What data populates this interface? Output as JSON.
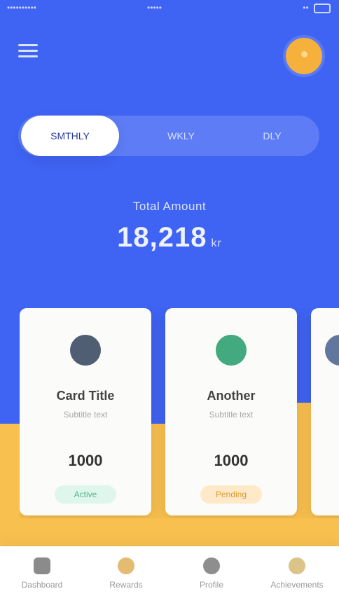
{
  "status_bar": {
    "left": "••••••••••",
    "center": "•••••",
    "right": "••"
  },
  "header": {
    "menu_icon": "menu-icon",
    "avatar_icon": "avatar-icon"
  },
  "tabs": [
    {
      "label": "SMTHLY"
    },
    {
      "label": "WKLY"
    },
    {
      "label": "DLY"
    }
  ],
  "summary": {
    "label": "Total Amount",
    "value": "18,218",
    "unit": "kr"
  },
  "cards": [
    {
      "title": "Card Title",
      "subtitle": "Subtitle text",
      "amount": "1000",
      "badge": "Active",
      "icon": "circle-icon"
    },
    {
      "title": "Another",
      "subtitle": "Subtitle text",
      "amount": "1000",
      "badge": "Pending",
      "icon": "leaf-icon"
    }
  ],
  "bottom_nav": [
    {
      "label": "Dashboard",
      "icon": "dashboard-icon"
    },
    {
      "label": "Rewards",
      "icon": "coin-icon"
    },
    {
      "label": "Profile",
      "icon": "user-icon"
    },
    {
      "label": "Achievements",
      "icon": "medal-icon"
    }
  ],
  "colors": {
    "primary": "#3f63f3",
    "accent": "#f8c04f"
  }
}
